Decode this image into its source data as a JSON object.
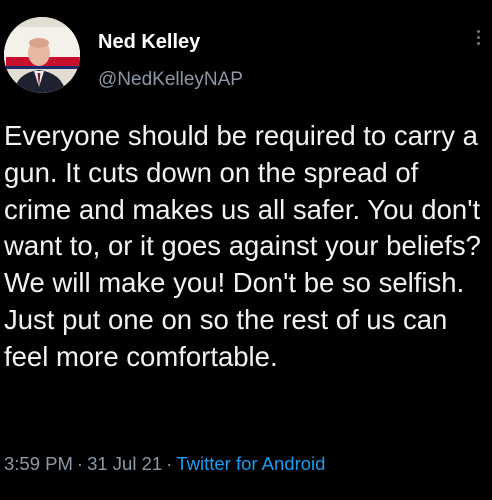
{
  "tweet": {
    "author": {
      "display_name": "Ned Kelley",
      "handle": "@NedKelleyNAP",
      "avatar_icon": "profile-photo"
    },
    "text": "Everyone should be required to carry a gun. It cuts down on the spread of crime and makes us all safer. You don't want to, or it goes against your beliefs? We will make you! Don't be so selfish. Just put one on so the rest of us can feel more comfortable.",
    "meta": {
      "time": "3:59 PM",
      "separator": "·",
      "date": "31 Jul 21",
      "source": "Twitter for Android"
    }
  },
  "colors": {
    "background": "#000000",
    "text": "#e7e9ea",
    "secondary": "#8b98a5",
    "link": "#1d9bf0"
  },
  "icons": {
    "more": "more-vertical-icon"
  }
}
